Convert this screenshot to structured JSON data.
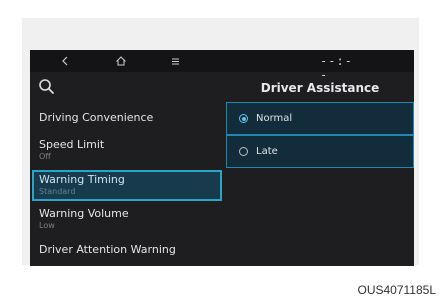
{
  "status_bar": {
    "back_icon": "chevron-left-icon",
    "home_icon": "home-icon",
    "menu_icon": "menu-lines-icon",
    "clock": "--:--"
  },
  "header": {
    "search_icon": "search-icon",
    "title": "Driver Assistance"
  },
  "menu": {
    "items": [
      {
        "label": "Driving Convenience",
        "value": ""
      },
      {
        "label": "Speed Limit",
        "value": "Off"
      },
      {
        "label": "Warning Timing",
        "value": "Standard",
        "selected": true
      },
      {
        "label": "Warning Volume",
        "value": "Low"
      },
      {
        "label": "Driver Attention Warning",
        "value": ""
      }
    ]
  },
  "options": {
    "items": [
      {
        "label": "Normal",
        "checked": true
      },
      {
        "label": "Late",
        "checked": false
      }
    ]
  },
  "colors": {
    "highlight_border": "#2aa5c6",
    "radio_active": "#5fc3e6",
    "screen_bg": "#1e1e20"
  },
  "caption": "OUS4071185L"
}
